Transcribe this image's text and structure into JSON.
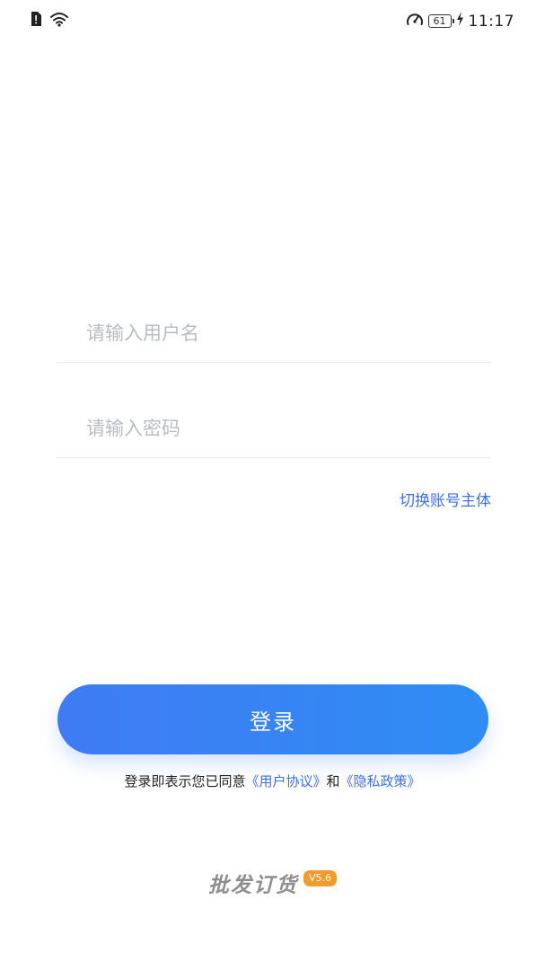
{
  "status_bar": {
    "battery_level": "61",
    "time": "11:17"
  },
  "login_form": {
    "username_placeholder": "请输入用户名",
    "username_value": "",
    "password_placeholder": "请输入密码",
    "password_value": "",
    "switch_account_label": "切换账号主体",
    "login_label": "登录"
  },
  "agreement": {
    "prefix": "登录即表示您已同意",
    "user_agreement": "《用户协议》",
    "and": "和",
    "privacy_policy": "《隐私政策》"
  },
  "brand": {
    "name": "批发订货",
    "version": "V5.6"
  },
  "colors": {
    "accent": "#3e6ff0",
    "button_start": "#3f7bf3",
    "button_end": "#2f8df5",
    "badge": "#f29a2b"
  }
}
